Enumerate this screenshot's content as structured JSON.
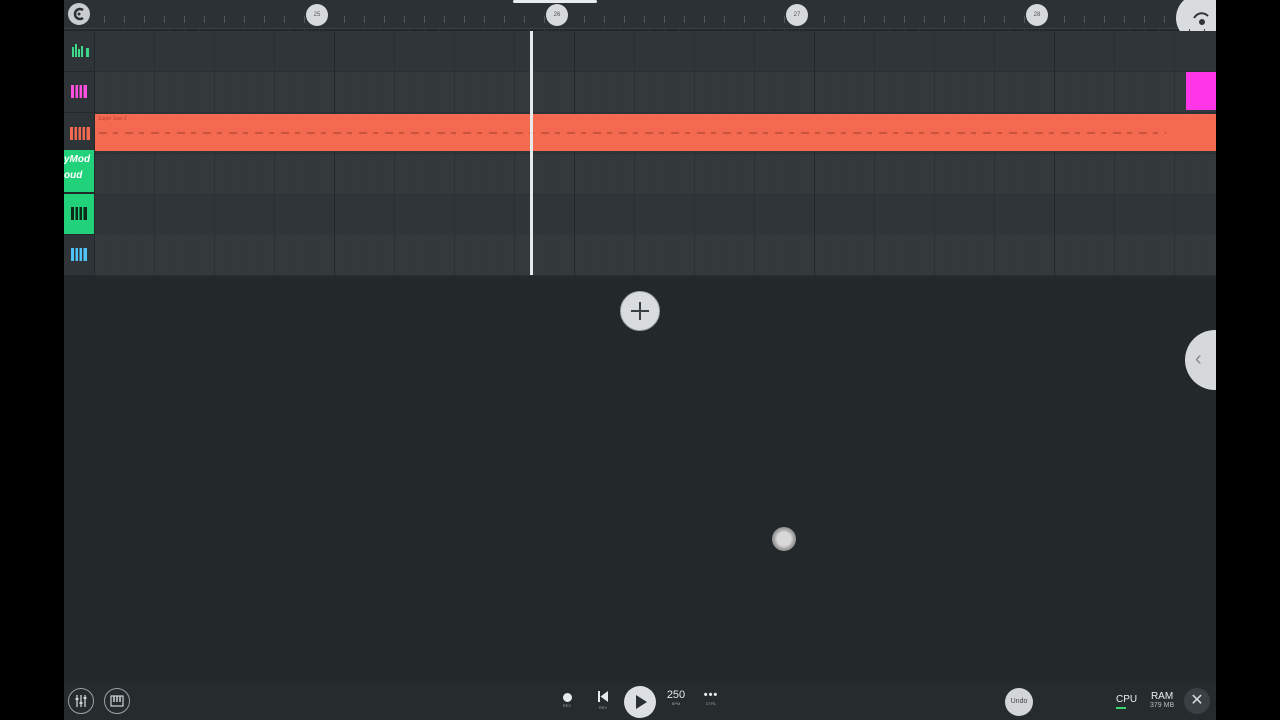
{
  "ruler": {
    "bar_markers": [
      "25",
      "26",
      "27",
      "28"
    ]
  },
  "tracks": [
    {
      "icon": "audio-levels-icon",
      "color": "#3ed98a"
    },
    {
      "icon": "piano-pink-icon",
      "color": "#ff4fe0"
    },
    {
      "icon": "piano-orange-icon",
      "color": "#f46a50"
    },
    {
      "icon": "plugin-green-icon",
      "color": "#22d27a"
    },
    {
      "icon": "piano-green-icon",
      "color": "#22d27a"
    },
    {
      "icon": "piano-blue-icon",
      "color": "#4fc3f7"
    }
  ],
  "clip": {
    "title": "Super Saw 2",
    "color": "#f46a50"
  },
  "watermark": {
    "line1": "yMod",
    "line2": "oud"
  },
  "transport": {
    "rec_caption": "REC",
    "rev_caption": "REV",
    "bpm": "250",
    "bpm_caption": "BPM",
    "ctrl_caption": "CTRL",
    "undo_label": "Undo"
  },
  "stats": {
    "cpu_label": "CPU",
    "ram_label": "RAM",
    "ram_value": "379 MB"
  }
}
